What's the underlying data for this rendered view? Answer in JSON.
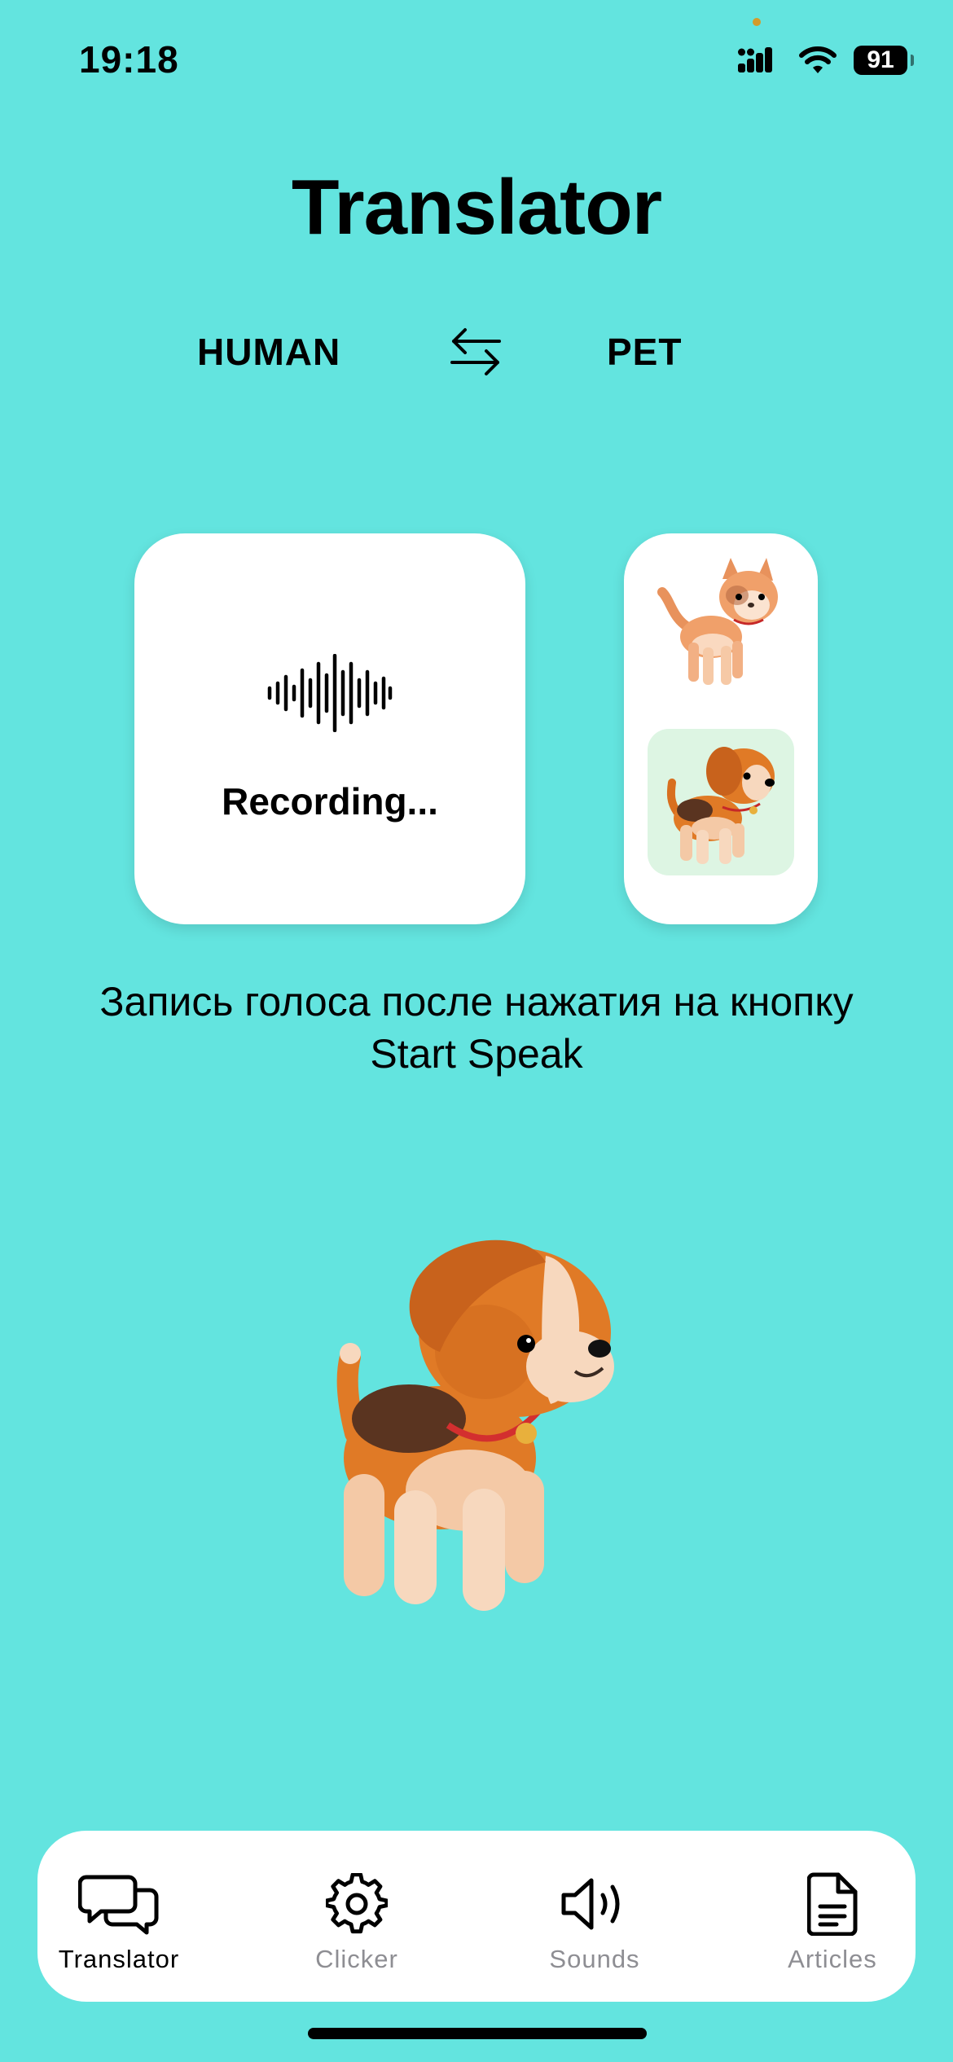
{
  "status_bar": {
    "time": "19:18",
    "battery": "91"
  },
  "header": {
    "title": "Translator"
  },
  "language_switch": {
    "from": "HUMAN",
    "to": "PET"
  },
  "recorder": {
    "status": "Recording..."
  },
  "pets": [
    {
      "name": "cat",
      "selected": false
    },
    {
      "name": "dog",
      "selected": true
    }
  ],
  "hint": {
    "line1": "Запись голоса после нажатия на кнопку",
    "line2": "Start Speak"
  },
  "tabs": [
    {
      "label": "Translator",
      "icon": "chat-bubbles-icon",
      "active": true
    },
    {
      "label": "Clicker",
      "icon": "gear-icon",
      "active": false
    },
    {
      "label": "Sounds",
      "icon": "speaker-icon",
      "active": false
    },
    {
      "label": "Articles",
      "icon": "document-icon",
      "active": false
    }
  ],
  "colors": {
    "background": "#63E4DF",
    "card": "#FFFFFF",
    "selected_pet_bg": "#DDF5E3",
    "inactive_tab": "#8E8E93"
  }
}
